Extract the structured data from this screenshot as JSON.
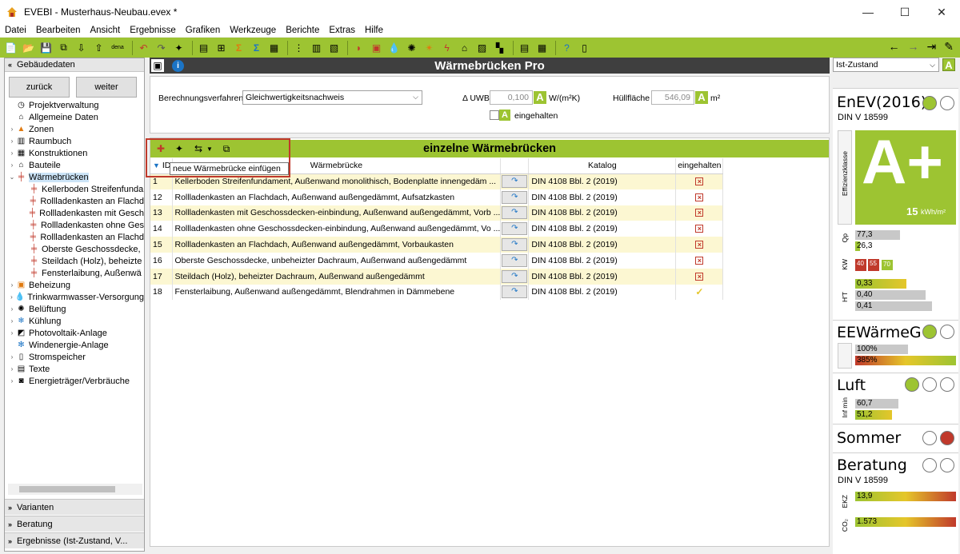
{
  "window": {
    "title": "EVEBI - Musterhaus-Neubau.evex *",
    "controls": [
      "minimize",
      "maximize",
      "close"
    ]
  },
  "menu": [
    "Datei",
    "Bearbeiten",
    "Ansicht",
    "Ergebnisse",
    "Grafiken",
    "Werkzeuge",
    "Berichte",
    "Extras",
    "Hilfe"
  ],
  "toolbar_extra_label": "dena",
  "left_panel": {
    "header": "Gebäudedaten",
    "back_label": "zurück",
    "next_label": "weiter",
    "tree": [
      {
        "label": "Projektverwaltung",
        "level": 0,
        "icon": "clock-icon"
      },
      {
        "label": "Allgemeine Daten",
        "level": 0,
        "icon": "house-icon"
      },
      {
        "label": "Zonen",
        "level": 0,
        "icon": "zones-icon",
        "expandable": true
      },
      {
        "label": "Raumbuch",
        "level": 0,
        "icon": "book-icon",
        "expandable": true
      },
      {
        "label": "Konstruktionen",
        "level": 0,
        "icon": "construction-icon",
        "expandable": true
      },
      {
        "label": "Bauteile",
        "level": 0,
        "icon": "building-part-icon",
        "expandable": true
      },
      {
        "label": "Wärmebrücken",
        "level": 0,
        "icon": "thermal-bridge-icon",
        "expanded": true,
        "selected": true
      },
      {
        "label": "Kellerboden Streifenfunda",
        "level": 1,
        "icon": "thermal-bridge-icon"
      },
      {
        "label": "Rollladenkasten an Flachd",
        "level": 1,
        "icon": "thermal-bridge-icon"
      },
      {
        "label": "Rollladenkasten mit Gesch",
        "level": 1,
        "icon": "thermal-bridge-icon"
      },
      {
        "label": "Rollladenkasten ohne Ges",
        "level": 1,
        "icon": "thermal-bridge-icon"
      },
      {
        "label": "Rollladenkasten an Flachd",
        "level": 1,
        "icon": "thermal-bridge-icon"
      },
      {
        "label": "Oberste Geschossdecke,",
        "level": 1,
        "icon": "thermal-bridge-icon"
      },
      {
        "label": "Steildach (Holz), beheizte",
        "level": 1,
        "icon": "thermal-bridge-icon"
      },
      {
        "label": "Fensterlaibung, Außenwä",
        "level": 1,
        "icon": "thermal-bridge-icon"
      },
      {
        "label": "Beheizung",
        "level": 0,
        "icon": "heating-icon",
        "expandable": true
      },
      {
        "label": "Trinkwarmwasser-Versorgung",
        "level": 0,
        "icon": "water-drop-icon",
        "expandable": true
      },
      {
        "label": "Belüftung",
        "level": 0,
        "icon": "fan-icon",
        "expandable": true
      },
      {
        "label": "Kühlung",
        "level": 0,
        "icon": "snowflake-icon",
        "expandable": true
      },
      {
        "label": "Photovoltaik-Anlage",
        "level": 0,
        "icon": "solar-icon",
        "expandable": true
      },
      {
        "label": "Windenergie-Anlage",
        "level": 0,
        "icon": "wind-icon"
      },
      {
        "label": "Stromspeicher",
        "level": 0,
        "icon": "battery-icon",
        "expandable": true
      },
      {
        "label": "Texte",
        "level": 0,
        "icon": "text-icon",
        "expandable": true
      },
      {
        "label": "Energieträger/Verbräuche",
        "level": 0,
        "icon": "meter-icon",
        "expandable": true
      }
    ],
    "sections": [
      "Varianten",
      "Beratung",
      "Ergebnisse (Ist-Zustand, V..."
    ]
  },
  "main": {
    "title": "Wärmebrücken Pro",
    "calc_method_label": "Berechnungsverfahren",
    "calc_method_value": "Gleichwertigkeitsnachweis",
    "uwb_label": "Δ UWB",
    "uwb_value": "0,100",
    "uwb_unit": "W/(m²K)",
    "huellflaeche_label": "Hüllfläche",
    "huellflaeche_value": "546,09",
    "huellflaeche_unit": "m²",
    "badge_letter": "A",
    "eingehalten_label": "eingehalten",
    "table_title": "einzelne Wärmebrücken",
    "tooltip": "neue Wärmebrücke einfügen",
    "columns": [
      "ID",
      "Wärmebrücke",
      "",
      "Katalog",
      "eingehalten"
    ],
    "rows": [
      {
        "id": "1",
        "name": "Kellerboden Streifenfundament, Außenwand monolithisch, Bodenplatte innengedäm ...",
        "catalog": "DIN 4108 Bbl. 2 (2019)",
        "ok": false
      },
      {
        "id": "12",
        "name": "Rollladenkasten an Flachdach, Außenwand außengedämmt, Aufsatzkasten",
        "catalog": "DIN 4108 Bbl. 2 (2019)",
        "ok": false
      },
      {
        "id": "13",
        "name": "Rollladenkasten mit Geschossdecken-einbindung, Außenwand außengedämmt, Vorb ...",
        "catalog": "DIN 4108 Bbl. 2 (2019)",
        "ok": false
      },
      {
        "id": "14",
        "name": "Rollladenkasten ohne Geschossdecken-einbindung, Außenwand außengedämmt, Vo ...",
        "catalog": "DIN 4108 Bbl. 2 (2019)",
        "ok": false
      },
      {
        "id": "15",
        "name": "Rollladenkasten an Flachdach, Außenwand außengedämmt, Vorbaukasten",
        "catalog": "DIN 4108 Bbl. 2 (2019)",
        "ok": false
      },
      {
        "id": "16",
        "name": "Oberste Geschossdecke, unbeheizter Dachraum, Außenwand außengedämmt",
        "catalog": "DIN 4108 Bbl. 2 (2019)",
        "ok": false
      },
      {
        "id": "17",
        "name": "Steildach (Holz), beheizter Dachraum, Außenwand außengedämmt",
        "catalog": "DIN 4108 Bbl. 2 (2019)",
        "ok": false
      },
      {
        "id": "18",
        "name": "Fensterlaibung, Außenwand außengedämmt, Blendrahmen in Dämmebene",
        "catalog": "DIN 4108 Bbl. 2 (2019)",
        "ok": true
      }
    ]
  },
  "right_panel": {
    "state_select": "Ist-Zustand",
    "state_badge": "A",
    "enev": {
      "title": "EnEV(2016)",
      "standard": "DIN V 18599",
      "efficiency_label": "Effizienzklasse",
      "efficiency_class": "A+",
      "value_text": "15",
      "value_unit": "kWh/m²",
      "qp_label": "Qp",
      "qp_values": [
        "77,3",
        "26,3"
      ],
      "kw_label": "KW",
      "kw_values": [
        "40",
        "55",
        "70"
      ],
      "ht_label": "H'T",
      "ht_values": [
        "0,33",
        "0,40",
        "0,41"
      ]
    },
    "eewaermeg": {
      "title": "EEWärmeG",
      "values": [
        "100%",
        "385%"
      ]
    },
    "luft": {
      "title": "Luft",
      "label": "Inf min",
      "values": [
        "60,7",
        "51,2"
      ]
    },
    "sommer": {
      "title": "Sommer"
    },
    "beratung": {
      "title": "Beratung",
      "standard": "DIN V 18599",
      "ekz_label": "EKZ",
      "ekz_value": "13,9",
      "co2_label": "CO₂",
      "co2_value": "1.573"
    },
    "colors": {
      "green": "#9dc432",
      "red": "#c0392b",
      "yellow": "#e5c62a",
      "gray": "#c8c8c8"
    }
  }
}
